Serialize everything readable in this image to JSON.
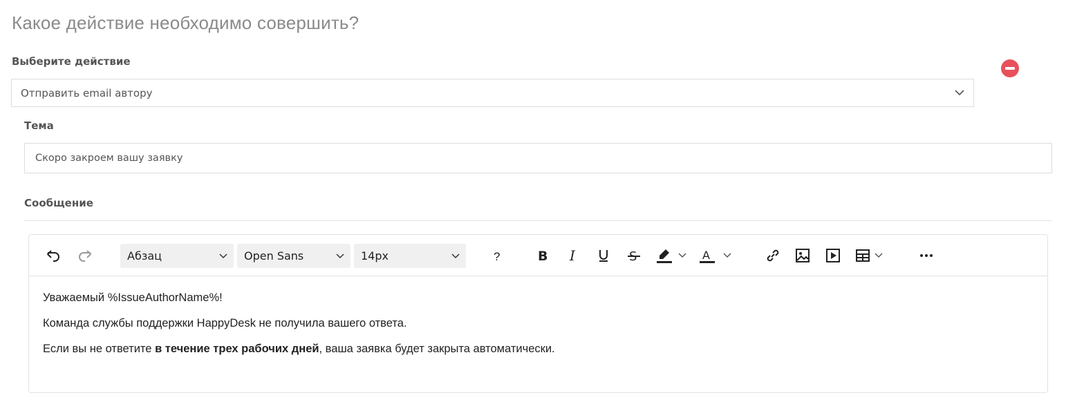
{
  "header": {
    "question": "Какое действие необходимо совершить?"
  },
  "action": {
    "label": "Выберите действие",
    "selected": "Отправить email автору"
  },
  "subject": {
    "label": "Тема",
    "value": "Скоро закроем вашу заявку"
  },
  "message": {
    "label": "Сообщение",
    "toolbar": {
      "paragraph": "Абзац",
      "font": "Open Sans",
      "size": "14px",
      "help": "?"
    },
    "body": {
      "line1": "Уважаемый %IssueAuthorName%!",
      "line2": "Команда службы поддержки HappyDesk не получила вашего ответа.",
      "line3_pre": "Если вы не ответите ",
      "line3_bold": "в течение трех рабочих дней",
      "line3_post": ", ваша заявка будет закрыта автоматически."
    }
  },
  "colors": {
    "remove": "#e8505b",
    "border": "#dcdcdc",
    "toolbar_select_bg": "#f0f0f0"
  },
  "icons": [
    "chevron-down-icon",
    "remove-icon",
    "undo-icon",
    "redo-icon",
    "bold-icon",
    "italic-icon",
    "underline-icon",
    "strikethrough-icon",
    "highlight-icon",
    "text-color-icon",
    "link-icon",
    "image-icon",
    "media-icon",
    "table-icon",
    "more-icon"
  ]
}
